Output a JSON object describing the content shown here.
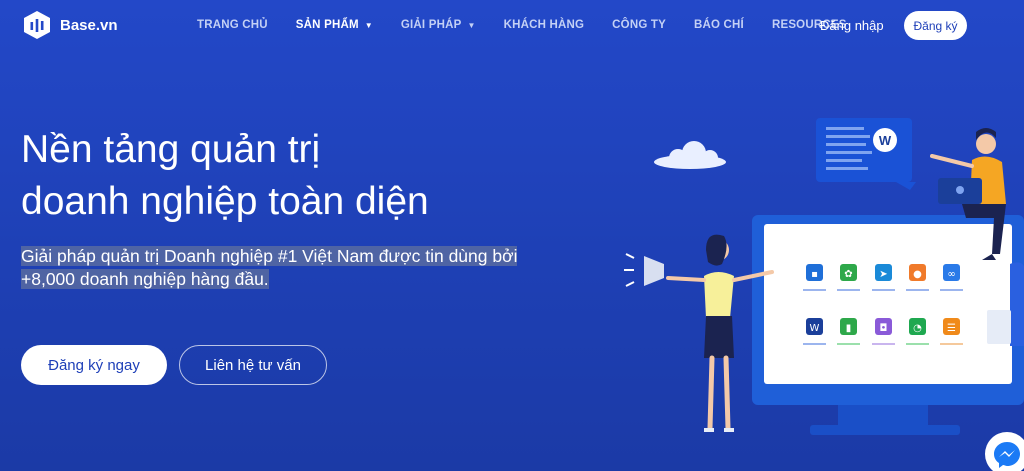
{
  "brand": {
    "name": "Base.vn"
  },
  "nav": {
    "items": [
      {
        "label": "TRANG CHỦ",
        "caret": ""
      },
      {
        "label": "SẢN PHẨM",
        "caret": "▼"
      },
      {
        "label": "GIẢI PHÁP",
        "caret": "▼"
      },
      {
        "label": "KHÁCH HÀNG",
        "caret": ""
      },
      {
        "label": "CÔNG TY",
        "caret": ""
      },
      {
        "label": "BÁO CHÍ",
        "caret": ""
      },
      {
        "label": "RESOURCES",
        "caret": ""
      }
    ],
    "login": "Đăng nhập",
    "signup": "Đăng ký"
  },
  "hero": {
    "title_line1": "Nền tảng quản trị",
    "title_line2": "doanh nghiệp toàn diện",
    "subtitle": "Giải pháp quản trị Doanh nghiệp #1 Việt Nam được tin dùng bởi +8,000 doanh nghiệp hàng đầu.",
    "cta_primary": "Đăng ký ngay",
    "cta_secondary": "Liên hệ tư vấn"
  },
  "illustration": {
    "bubble_badge": "W",
    "app_tiles_row1": [
      "#1f6fd8",
      "#2ea84a",
      "#1a8ad8",
      "#f07a2a",
      "#2a7ae8"
    ],
    "app_tiles_row2": [
      "#1b3f9a",
      "#2ea84a",
      "#8a5ad8",
      "#1fa850",
      "#f08a1a"
    ],
    "app_glyphs_row1": [
      "▪",
      "✿",
      "➤",
      "●",
      "∞"
    ],
    "app_glyphs_row2": [
      "W",
      "▮",
      "◘",
      "◔",
      "☰"
    ]
  },
  "colors": {
    "background": "#2348c8",
    "accent": "#1e3fb8",
    "monitor_frame": "#1f5fd8"
  }
}
